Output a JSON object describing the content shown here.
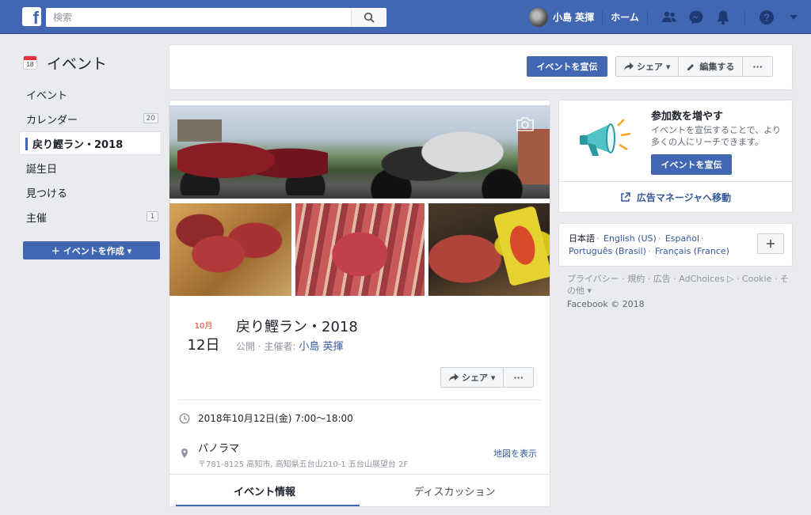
{
  "topbar": {
    "logo": "f",
    "search_placeholder": "検索",
    "user_name": "小島 英揮",
    "home_label": "ホーム",
    "icons": [
      "friends-icon",
      "messenger-icon",
      "notifications-icon",
      "help-icon",
      "caret-down-icon"
    ]
  },
  "sidebar": {
    "title": "イベント",
    "calendar_icon_day": "18",
    "items": [
      {
        "label": "イベント",
        "badge": ""
      },
      {
        "label": "カレンダー",
        "badge": "20"
      },
      {
        "label": "戻り鰹ラン・2018",
        "badge": ""
      },
      {
        "label": "誕生日",
        "badge": ""
      },
      {
        "label": "見つける",
        "badge": ""
      },
      {
        "label": "主催",
        "badge": "1"
      }
    ],
    "create_label": "＋ イベントを作成 ▾"
  },
  "actionbar": {
    "promote_label": "イベントを宣伝",
    "share_label": "シェア ▾",
    "edit_label": "編集する",
    "more_label": "···"
  },
  "event": {
    "month": "10月",
    "day": "12日",
    "title": "戻り鰹ラン・2018",
    "privacy": "公開 · 主催者:",
    "host": "小島 英揮",
    "share_label": "シェア ▾",
    "more_label": "···",
    "datetime": "2018年10月12日(金) 7:00～18:00",
    "place_name": "パノラマ",
    "place_address": "〒781-8125 高知市, 高知県五台山210-1 五台山展望台 2F",
    "map_link": "地図を表示",
    "tabs": [
      "イベント情報",
      "ディスカッション"
    ]
  },
  "promo": {
    "title": "参加数を増やす",
    "desc": "イベントを宣伝することで、より多くの人にリーチできます。",
    "button": "イベントを宣伝",
    "ads_link": "広告マネージャへ移動"
  },
  "languages": {
    "current": "日本語",
    "others": [
      "English (US)",
      "Español",
      "Português (Brasil)",
      "Français (France)"
    ]
  },
  "footer": {
    "links": "プライバシー · 規約 · 広告 · AdChoices ▷ · Cookie · その他 ▾",
    "copyright": "Facebook © 2018"
  },
  "colors": {
    "brand": "#4267b2",
    "link": "#365899",
    "date_red": "#e43a2c",
    "background": "#e9ebee"
  }
}
